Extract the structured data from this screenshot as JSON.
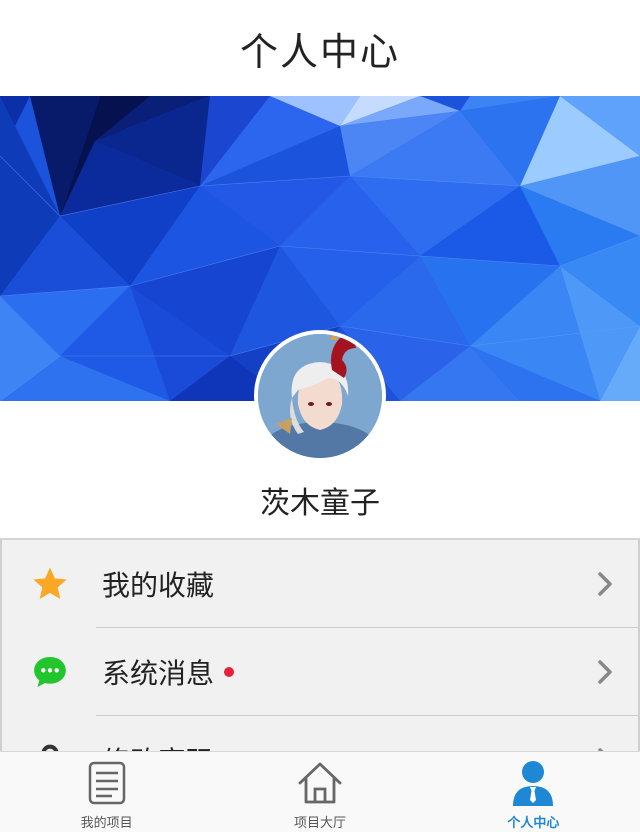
{
  "header": {
    "title": "个人中心"
  },
  "profile": {
    "username": "茨木童子",
    "avatar_icon": "user-avatar-icon"
  },
  "menu": {
    "items": [
      {
        "label": "我的收藏",
        "icon": "star-icon",
        "icon_color": "#f9a825",
        "has_dot": false
      },
      {
        "label": "系统消息",
        "icon": "chat-bubble-icon",
        "icon_color": "#22c52b",
        "has_dot": true
      },
      {
        "label": "修改密码",
        "icon": "lock-icon",
        "icon_color": "#333333",
        "has_dot": false
      }
    ]
  },
  "tabbar": {
    "tabs": [
      {
        "label": "我的项目",
        "icon": "list-icon",
        "active": false
      },
      {
        "label": "项目大厅",
        "icon": "home-icon",
        "active": false
      },
      {
        "label": "个人中心",
        "icon": "person-icon",
        "active": true
      }
    ]
  },
  "colors": {
    "accent": "#1f88d4",
    "notification_dot": "#e8203a",
    "banner_blue": "#1a4fd8"
  }
}
